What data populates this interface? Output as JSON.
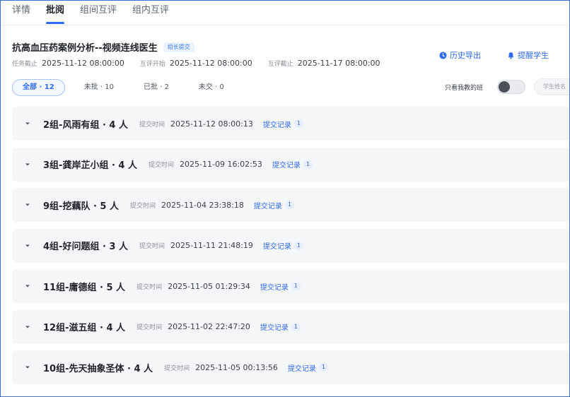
{
  "tabs": [
    {
      "label": "详情"
    },
    {
      "label": "批阅"
    },
    {
      "label": "组间互评"
    },
    {
      "label": "组内互评"
    }
  ],
  "header": {
    "title": "抗高血压药案例分析--视频连线医生",
    "badge": "组长提交",
    "meta": [
      {
        "label": "任务截止",
        "value": "2025-11-12 08:00:00"
      },
      {
        "label": "互评开始",
        "value": "2025-11-12 08:00:00"
      },
      {
        "label": "互评截止",
        "value": "2025-11-17 08:00:00"
      }
    ],
    "export_label": "历史导出",
    "remind_label": "提醒学生"
  },
  "filters": [
    {
      "label": "全部 · 12"
    },
    {
      "label": "未批 · 10"
    },
    {
      "label": "已批 · 2"
    },
    {
      "label": "未交 · 0"
    }
  ],
  "only_mine_label": "只看我教的班",
  "search_placeholder": "学生姓名",
  "groups": [
    {
      "name": "2组-风雨有组 · 4 人",
      "time_label": "提交时间",
      "time": "2025-11-12 08:00:13",
      "record_label": "提交记录",
      "record_count": "1"
    },
    {
      "name": "3组-龚岸芷小组 · 4 人",
      "time_label": "提交时间",
      "time": "2025-11-09 16:02:53",
      "record_label": "提交记录",
      "record_count": "1"
    },
    {
      "name": "9组-挖藕队 · 5 人",
      "time_label": "提交时间",
      "time": "2025-11-04 23:38:18",
      "record_label": "提交记录",
      "record_count": "1"
    },
    {
      "name": "4组-好问题组 · 3 人",
      "time_label": "提交时间",
      "time": "2025-11-11 21:48:19",
      "record_label": "提交记录",
      "record_count": "1"
    },
    {
      "name": "11组-庸德组 · 5 人",
      "time_label": "提交时间",
      "time": "2025-11-05 01:29:34",
      "record_label": "提交记录",
      "record_count": "1"
    },
    {
      "name": "12组-滋五组 · 4 人",
      "time_label": "提交时间",
      "time": "2025-11-02 22:47:20",
      "record_label": "提交记录",
      "record_count": "1"
    },
    {
      "name": "10组-先天抽象圣体 · 4 人",
      "time_label": "提交时间",
      "time": "2025-11-05 00:13:56",
      "record_label": "提交记录",
      "record_count": "1"
    }
  ],
  "colors": {
    "accent": "#2f6bf0",
    "row_bg": "#f5f6f8",
    "border": "#3b6fd8"
  }
}
